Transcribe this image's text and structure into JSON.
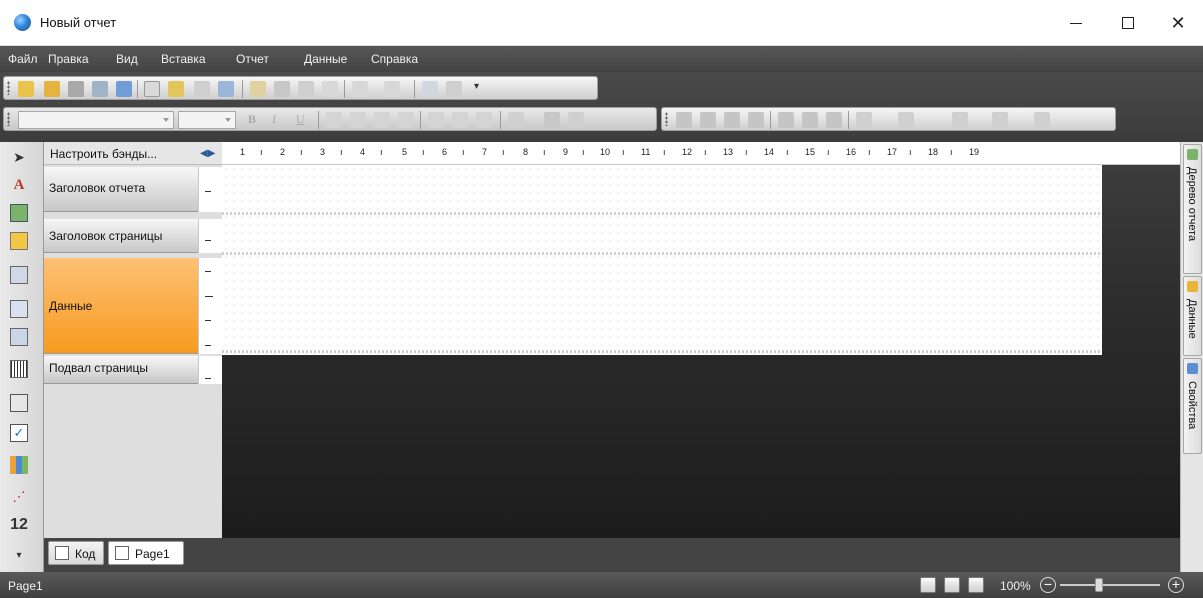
{
  "window": {
    "title": "Новый отчет"
  },
  "menu": {
    "items": [
      "Файл",
      "Правка",
      "Вид",
      "Вставка",
      "Отчет",
      "Данные",
      "Справка"
    ]
  },
  "bands": {
    "configure_label": "Настроить бэнды...",
    "items": [
      {
        "label": "Заголовок отчета"
      },
      {
        "label": "Заголовок страницы"
      },
      {
        "label": "Данные"
      },
      {
        "label": "Подвал страницы"
      }
    ]
  },
  "ruler": {
    "numbers": [
      "1",
      "2",
      "3",
      "4",
      "5",
      "6",
      "7",
      "8",
      "9",
      "10",
      "11",
      "12",
      "13",
      "14",
      "15",
      "16",
      "17",
      "18",
      "19"
    ]
  },
  "right_tabs": {
    "report_tree": "Дерево отчета",
    "data": "Данные",
    "properties": "Свойства"
  },
  "doc_tabs": {
    "code": "Код",
    "page": "Page1"
  },
  "status": {
    "text": "Page1",
    "zoom": "100%"
  },
  "left_toolbox": {
    "number_label": "12"
  },
  "colors": {
    "active_band": "#f79a1f",
    "menubar": "#4a4a4a"
  }
}
